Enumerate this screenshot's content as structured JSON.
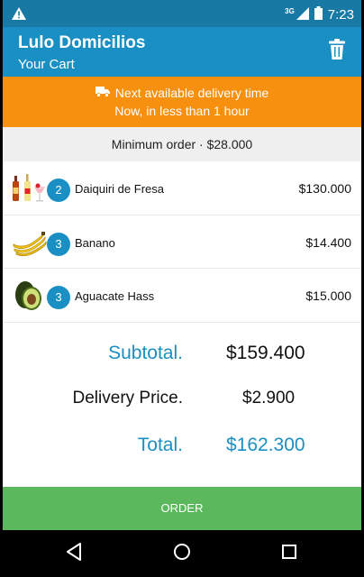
{
  "status_bar": {
    "network": "3G",
    "time": "7:23",
    "icons": [
      "warning-icon",
      "signal-icon",
      "battery-icon"
    ]
  },
  "app_bar": {
    "title": "Lulo Domicilios",
    "subtitle": "Your Cart",
    "action_icon": "trash-icon"
  },
  "delivery_banner": {
    "icon": "truck-icon",
    "line1": "Next available delivery time",
    "line2": "Now, in less than 1 hour"
  },
  "minimum_order": "Minimum order · $28.000",
  "items": [
    {
      "image": "cocktail-bottles",
      "quantity": "2",
      "name": "Daiquiri de Fresa",
      "price": "$130.000"
    },
    {
      "image": "bananas",
      "quantity": "3",
      "name": "Banano",
      "price": "$14.400"
    },
    {
      "image": "avocado",
      "quantity": "3",
      "name": "Aguacate Hass",
      "price": "$15.000"
    }
  ],
  "totals": {
    "subtotal_label": "Subtotal.",
    "subtotal_value": "$159.400",
    "delivery_label": "Delivery Price.",
    "delivery_value": "$2.900",
    "total_label": "Total.",
    "total_value": "$162.300"
  },
  "order_button": "ORDER",
  "nav_bar": [
    "back-icon",
    "home-icon",
    "recents-icon"
  ],
  "colors": {
    "status_bar": "#1779a4",
    "primary": "#1a8fc3",
    "banner": "#f6900e",
    "order_button": "#5cb85c"
  }
}
